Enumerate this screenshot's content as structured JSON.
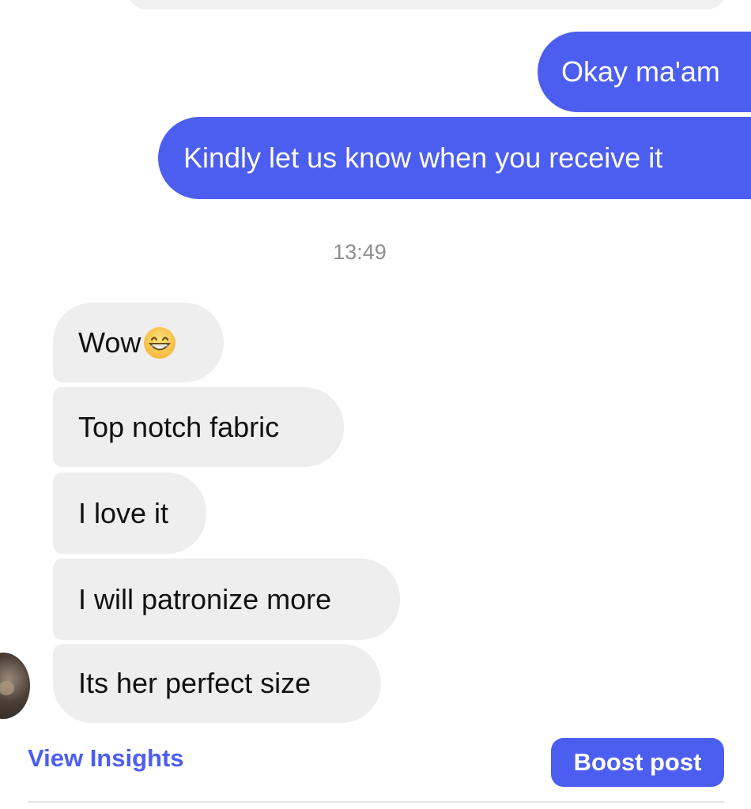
{
  "conversation": {
    "outgoing_messages": [
      {
        "text": "Okay ma'am"
      },
      {
        "text": "Kindly let us know when you receive it"
      }
    ],
    "timestamp": "13:49",
    "incoming_messages": [
      {
        "text": "Wow",
        "emoji": "grinning-face-with-smiling-eyes"
      },
      {
        "text": "Top notch fabric"
      },
      {
        "text": "I love it"
      },
      {
        "text": "I will patronize more"
      },
      {
        "text": "Its her perfect size"
      }
    ]
  },
  "footer": {
    "insights_label": "View Insights",
    "boost_label": "Boost post"
  },
  "colors": {
    "accent": "#4c5ef0",
    "incoming_bubble": "#eeeeef",
    "timestamp_text": "#8e8e93"
  }
}
